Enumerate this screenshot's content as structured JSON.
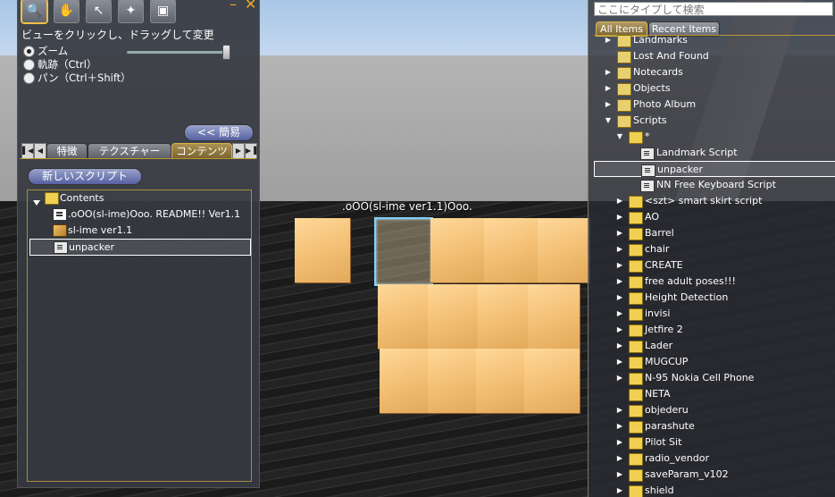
{
  "scene": {
    "floating_text": ".oOO(sl-ime ver1.1)Ooo."
  },
  "tools": {
    "buttons": [
      {
        "name": "zoom-tool",
        "glyph": "🔍"
      },
      {
        "name": "grab-tool",
        "glyph": "✋"
      },
      {
        "name": "select-tool",
        "glyph": "↖"
      },
      {
        "name": "create-tool",
        "glyph": "✦"
      },
      {
        "name": "land-tool",
        "glyph": "▣"
      }
    ],
    "minimize": "–",
    "close": "✕",
    "hint": "ビューをクリックし、ドラッグして変更",
    "modes": [
      {
        "label": "ズーム",
        "selected": true
      },
      {
        "label": "軌跡（Ctrl）",
        "selected": false
      },
      {
        "label": "パン（Ctrl＋Shift）",
        "selected": false
      }
    ],
    "simple_button": "<< 簡易",
    "tabs": [
      "特徴",
      "テクスチャー",
      "コンテンツ"
    ],
    "active_tab": "コンテンツ",
    "new_script_button": "新しいスクリプト",
    "contents": {
      "root": "Contents",
      "items": [
        {
          "label": ".oOO(sl-ime)Ooo.  README!! Ver1.1",
          "type": "notecard"
        },
        {
          "label": "sl-ime ver1.1",
          "type": "object"
        },
        {
          "label": "unpacker",
          "type": "script",
          "selected": true
        }
      ]
    }
  },
  "inventory": {
    "search_placeholder": "ここにタイプして検索",
    "tabs": [
      "All Items",
      "Recent Items"
    ],
    "active_tab": "All Items",
    "items": [
      {
        "label": "Landmarks",
        "type": "system",
        "level": 0,
        "expand": "closed"
      },
      {
        "label": "Lost And Found",
        "type": "system",
        "level": 0,
        "expand": "none"
      },
      {
        "label": "Notecards",
        "type": "system",
        "level": 0,
        "expand": "closed"
      },
      {
        "label": "Objects",
        "type": "system",
        "level": 0,
        "expand": "closed"
      },
      {
        "label": "Photo Album",
        "type": "system",
        "level": 0,
        "expand": "closed"
      },
      {
        "label": "Scripts",
        "type": "system",
        "level": 0,
        "expand": "open"
      },
      {
        "label": "*",
        "type": "folder",
        "level": 1,
        "expand": "open"
      },
      {
        "label": "Landmark Script",
        "type": "script",
        "level": 2,
        "expand": "none"
      },
      {
        "label": "unpacker",
        "type": "script",
        "level": 2,
        "expand": "none",
        "selected": true
      },
      {
        "label": "NN Free Keyboard Script",
        "type": "script",
        "level": 2,
        "expand": "none"
      },
      {
        "label": "<szt> smart skirt script",
        "type": "folder",
        "level": 1,
        "expand": "closed"
      },
      {
        "label": "AO",
        "type": "folder",
        "level": 1,
        "expand": "closed"
      },
      {
        "label": "Barrel",
        "type": "folder",
        "level": 1,
        "expand": "closed"
      },
      {
        "label": "chair",
        "type": "folder",
        "level": 1,
        "expand": "closed"
      },
      {
        "label": "CREATE",
        "type": "folder",
        "level": 1,
        "expand": "closed"
      },
      {
        "label": "free adult poses!!!",
        "type": "folder",
        "level": 1,
        "expand": "closed"
      },
      {
        "label": "Height Detection",
        "type": "folder",
        "level": 1,
        "expand": "closed"
      },
      {
        "label": "invisi",
        "type": "folder",
        "level": 1,
        "expand": "closed"
      },
      {
        "label": "Jetfire 2",
        "type": "folder",
        "level": 1,
        "expand": "closed"
      },
      {
        "label": "Lader",
        "type": "folder",
        "level": 1,
        "expand": "closed"
      },
      {
        "label": "MUGCUP",
        "type": "folder",
        "level": 1,
        "expand": "closed"
      },
      {
        "label": "N-95 Nokia Cell Phone",
        "type": "folder",
        "level": 1,
        "expand": "closed"
      },
      {
        "label": "NETA",
        "type": "folder",
        "level": 1,
        "expand": "none"
      },
      {
        "label": "objederu",
        "type": "folder",
        "level": 1,
        "expand": "closed"
      },
      {
        "label": "parashute",
        "type": "folder",
        "level": 1,
        "expand": "closed"
      },
      {
        "label": "Pilot Sit",
        "type": "folder",
        "level": 1,
        "expand": "closed"
      },
      {
        "label": "radio_vendor",
        "type": "folder",
        "level": 1,
        "expand": "closed"
      },
      {
        "label": "saveParam_v102",
        "type": "folder",
        "level": 1,
        "expand": "closed"
      },
      {
        "label": "shield",
        "type": "folder",
        "level": 1,
        "expand": "closed"
      }
    ]
  }
}
